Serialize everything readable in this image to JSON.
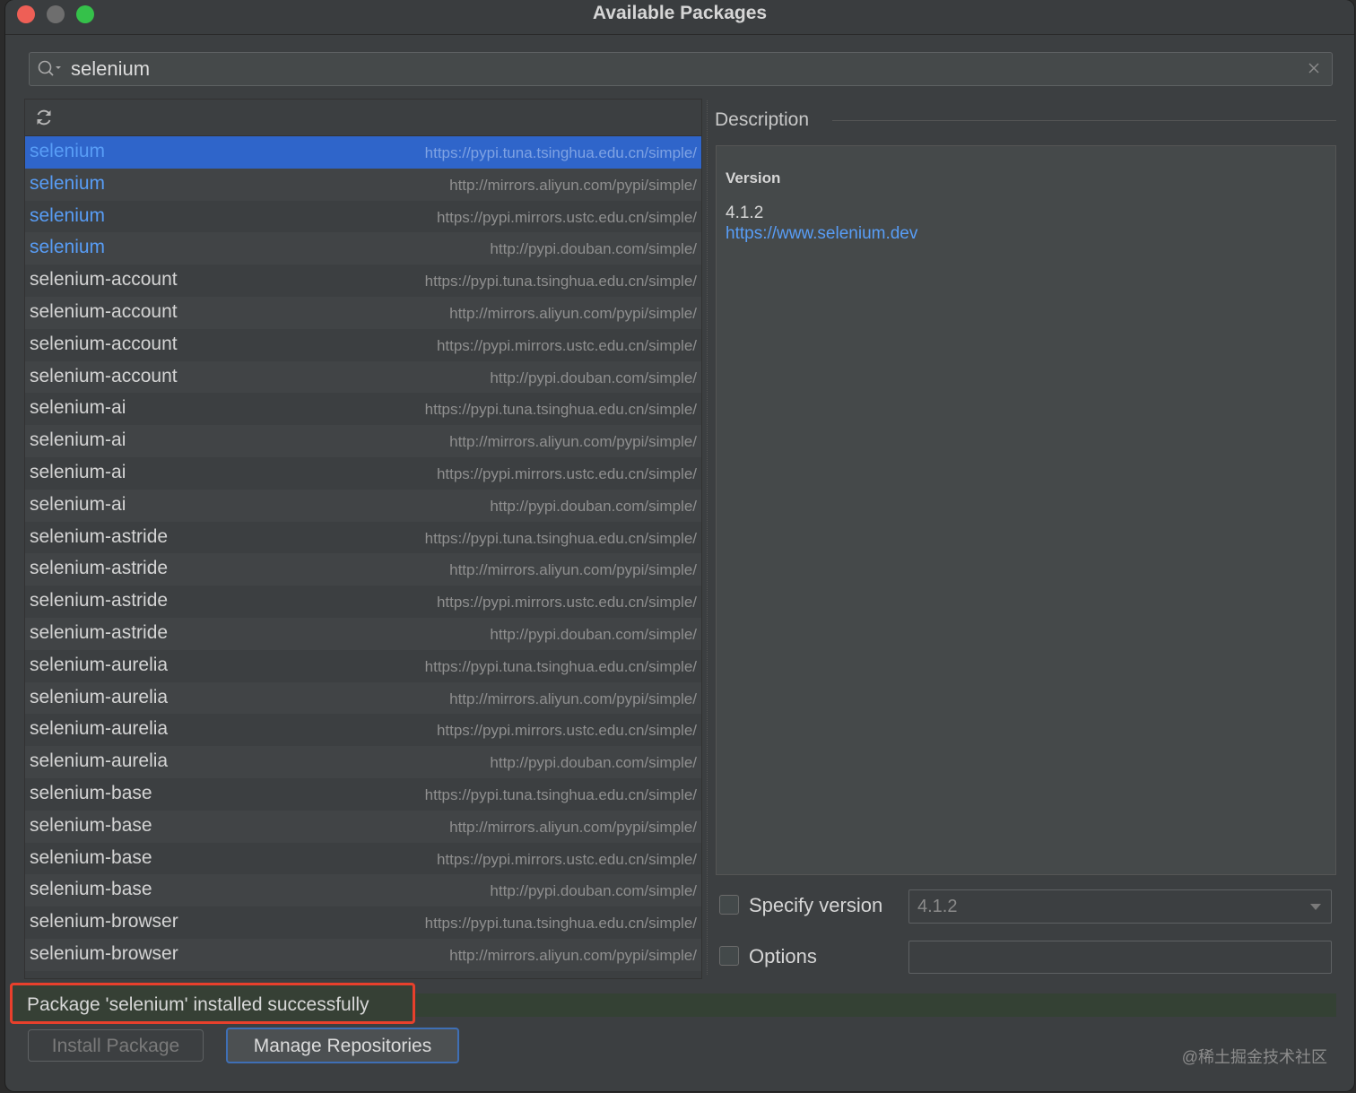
{
  "window": {
    "title": "Available Packages"
  },
  "search": {
    "value": "selenium"
  },
  "packages": [
    {
      "name": "selenium",
      "repo": "https://pypi.tuna.tsinghua.edu.cn/simple/"
    },
    {
      "name": "selenium",
      "repo": "http://mirrors.aliyun.com/pypi/simple/"
    },
    {
      "name": "selenium",
      "repo": "https://pypi.mirrors.ustc.edu.cn/simple/"
    },
    {
      "name": "selenium",
      "repo": "http://pypi.douban.com/simple/"
    },
    {
      "name": "selenium-account",
      "repo": "https://pypi.tuna.tsinghua.edu.cn/simple/"
    },
    {
      "name": "selenium-account",
      "repo": "http://mirrors.aliyun.com/pypi/simple/"
    },
    {
      "name": "selenium-account",
      "repo": "https://pypi.mirrors.ustc.edu.cn/simple/"
    },
    {
      "name": "selenium-account",
      "repo": "http://pypi.douban.com/simple/"
    },
    {
      "name": "selenium-ai",
      "repo": "https://pypi.tuna.tsinghua.edu.cn/simple/"
    },
    {
      "name": "selenium-ai",
      "repo": "http://mirrors.aliyun.com/pypi/simple/"
    },
    {
      "name": "selenium-ai",
      "repo": "https://pypi.mirrors.ustc.edu.cn/simple/"
    },
    {
      "name": "selenium-ai",
      "repo": "http://pypi.douban.com/simple/"
    },
    {
      "name": "selenium-astride",
      "repo": "https://pypi.tuna.tsinghua.edu.cn/simple/"
    },
    {
      "name": "selenium-astride",
      "repo": "http://mirrors.aliyun.com/pypi/simple/"
    },
    {
      "name": "selenium-astride",
      "repo": "https://pypi.mirrors.ustc.edu.cn/simple/"
    },
    {
      "name": "selenium-astride",
      "repo": "http://pypi.douban.com/simple/"
    },
    {
      "name": "selenium-aurelia",
      "repo": "https://pypi.tuna.tsinghua.edu.cn/simple/"
    },
    {
      "name": "selenium-aurelia",
      "repo": "http://mirrors.aliyun.com/pypi/simple/"
    },
    {
      "name": "selenium-aurelia",
      "repo": "https://pypi.mirrors.ustc.edu.cn/simple/"
    },
    {
      "name": "selenium-aurelia",
      "repo": "http://pypi.douban.com/simple/"
    },
    {
      "name": "selenium-base",
      "repo": "https://pypi.tuna.tsinghua.edu.cn/simple/"
    },
    {
      "name": "selenium-base",
      "repo": "http://mirrors.aliyun.com/pypi/simple/"
    },
    {
      "name": "selenium-base",
      "repo": "https://pypi.mirrors.ustc.edu.cn/simple/"
    },
    {
      "name": "selenium-base",
      "repo": "http://pypi.douban.com/simple/"
    },
    {
      "name": "selenium-browser",
      "repo": "https://pypi.tuna.tsinghua.edu.cn/simple/"
    },
    {
      "name": "selenium-browser",
      "repo": "http://mirrors.aliyun.com/pypi/simple/"
    }
  ],
  "description": {
    "header": "Description",
    "version_label": "Version",
    "version_value": "4.1.2",
    "link": "https://www.selenium.dev"
  },
  "options": {
    "specify_version_label": "Specify version",
    "specify_version_value": "4.1.2",
    "options_label": "Options",
    "options_value": ""
  },
  "status": {
    "message": "Package 'selenium' installed successfully"
  },
  "buttons": {
    "install": "Install Package",
    "manage": "Manage Repositories"
  },
  "watermark": "@稀土掘金技术社区",
  "colors": {
    "selection": "#2f65ca",
    "link": "#589df6",
    "highlight_border": "#e8402c",
    "success_bg": "#344134"
  }
}
